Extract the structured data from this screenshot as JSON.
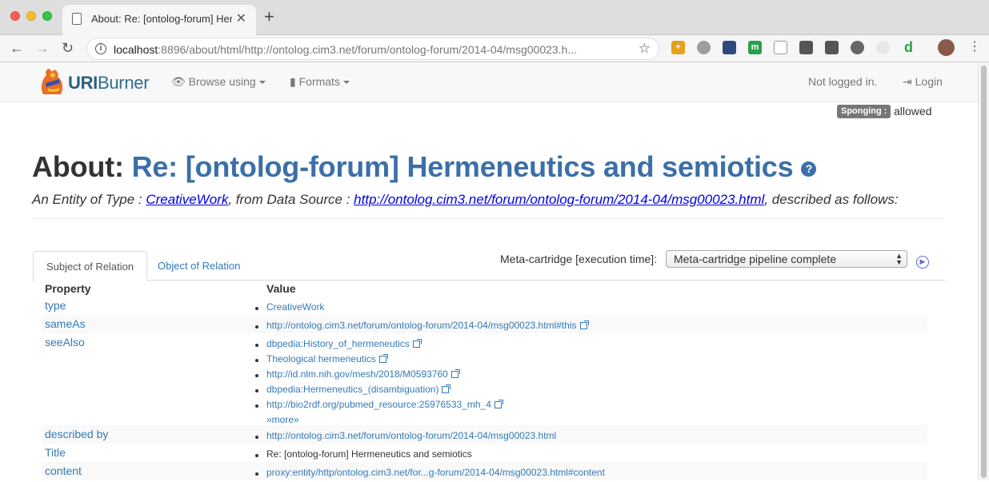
{
  "browser": {
    "tab_title": "About: Re: [ontolog-forum] Her",
    "url_host": "localhost",
    "url_rest": ":8896/about/html/http://ontolog.cim3.net/forum/ontolog-forum/2014-04/msg00023.h..."
  },
  "navbar": {
    "brand_bold": "URI",
    "brand_rest": "Burner",
    "browse_label": "Browse using",
    "formats_label": "Formats",
    "login_status": "Not logged in.",
    "login_label": "Login"
  },
  "sponging": {
    "label": "Sponging :",
    "value": "allowed"
  },
  "header": {
    "prefix": "About: ",
    "subject": "Re: [ontolog-forum] Hermeneutics and semiotics",
    "help_glyph": "?",
    "desc_prefix": "An Entity of Type : ",
    "type_link": "CreativeWork",
    "desc_mid": ", from Data Source : ",
    "source_link": "http://ontolog.cim3.net/forum/ontolog-forum/2014-04/msg00023.html",
    "desc_suffix": ", described as follows:"
  },
  "tabs": {
    "subject": "Subject of Relation",
    "object": "Object of Relation"
  },
  "metacartridge": {
    "label": "Meta-cartridge [execution time]:",
    "selected": "Meta-cartridge pipeline complete"
  },
  "table": {
    "col_property": "Property",
    "col_value": "Value",
    "rows": [
      {
        "property": "type",
        "values": [
          "CreativeWork"
        ],
        "external": [
          false
        ]
      },
      {
        "property": "sameAs",
        "values": [
          "http://ontolog.cim3.net/forum/ontolog-forum/2014-04/msg00023.html#this"
        ],
        "external": [
          true
        ]
      },
      {
        "property": "seeAlso",
        "values": [
          "dbpedia:History_of_hermeneutics",
          "Theological hermeneutics",
          "http://id.nlm.nih.gov/mesh/2018/M0593760",
          "dbpedia:Hermeneutics_(disambiguation)",
          "http://bio2rdf.org/pubmed_resource:25976533_mh_4"
        ],
        "external": [
          true,
          true,
          true,
          true,
          true
        ],
        "more": "»more»"
      },
      {
        "property": "described by",
        "values": [
          "http://ontolog.cim3.net/forum/ontolog-forum/2014-04/msg00023.html"
        ],
        "external": [
          false
        ]
      },
      {
        "property": "Title",
        "values": [
          "Re: [ontolog-forum] Hermeneutics and semiotics"
        ],
        "external": [
          false
        ],
        "plain": true
      },
      {
        "property": "content",
        "values": [
          "proxy:entity/http/ontolog.cim3.net/for...g-forum/2014-04/msg00023.html#content"
        ],
        "external": [
          false
        ]
      }
    ]
  },
  "colors": {
    "accent": "#3b6fa8",
    "link": "#337ab7"
  }
}
